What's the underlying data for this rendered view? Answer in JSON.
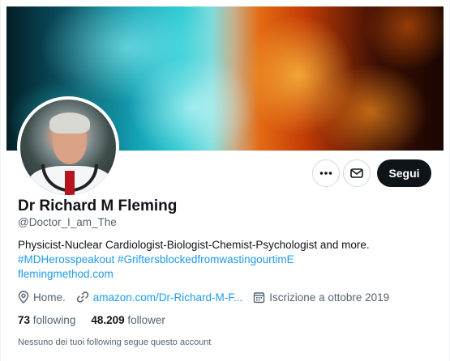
{
  "profile": {
    "name": "Dr Richard M Fleming",
    "handle": "@Doctor_I_am_The",
    "bio_line": "Physicist-Nuclear Cardiologist-Biologist-Chemist-Psychologist and more.",
    "bio_hashtags": "#MDHerosspeakout #GriftersblockedfromwastingourtimE",
    "bio_link": "flemingmethod.com"
  },
  "actions": {
    "more_icon": "more-horizontal-icon",
    "message_icon": "envelope-icon",
    "follow_label": "Segui"
  },
  "meta": {
    "location": "Home.",
    "website": "amazon.com/Dr-Richard-M-F...",
    "joined": "Iscrizione a ottobre 2019"
  },
  "counts": {
    "following_count": "73",
    "following_label": "following",
    "followers_count": "48.209",
    "followers_label": "follower"
  },
  "mutuals_note": "Nessuno dei tuoi following segue questo account",
  "colors": {
    "accent": "#1d9bf0",
    "text": "#0f1419",
    "secondary_text": "#536471",
    "follow_button_bg": "#0f1419"
  }
}
